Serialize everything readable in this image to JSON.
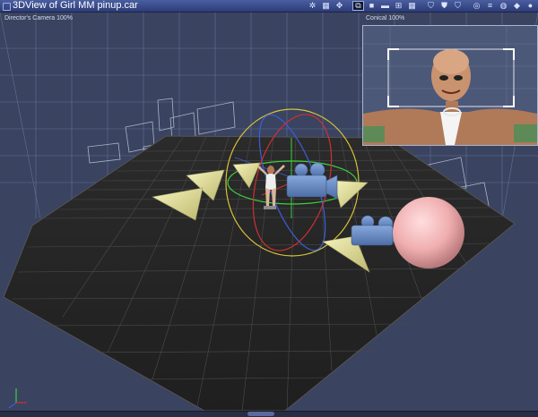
{
  "window": {
    "title": "3DView of Girl MM pinup.car"
  },
  "toolbar": {
    "items": [
      {
        "icon": "pin-icon",
        "glyph": "✲"
      },
      {
        "icon": "grid-icon",
        "glyph": "▦"
      },
      {
        "icon": "move-icon",
        "glyph": "✥"
      },
      {
        "icon": "camera-view-icon",
        "glyph": "⧉"
      },
      {
        "icon": "layout-single-icon",
        "glyph": "■"
      },
      {
        "icon": "layout-split-icon",
        "glyph": "▬"
      },
      {
        "icon": "layout-quad-icon",
        "glyph": "⊞"
      },
      {
        "icon": "layout-grid-icon",
        "glyph": "▦"
      },
      {
        "icon": "shield-icon",
        "glyph": "⛉"
      },
      {
        "icon": "light-shield-icon",
        "glyph": "⛊"
      },
      {
        "icon": "render-shield-icon",
        "glyph": "⛉"
      },
      {
        "icon": "target-icon",
        "glyph": "◎"
      },
      {
        "icon": "menu-icon",
        "glyph": "≡"
      },
      {
        "icon": "wireframe-sphere-icon",
        "glyph": "◍"
      },
      {
        "icon": "shaded-cube-icon",
        "glyph": "◆"
      },
      {
        "icon": "shaded-sphere-icon",
        "glyph": "●"
      }
    ]
  },
  "viewport": {
    "camera_label": "Director's Camera 100%",
    "preview_label": "Conical 100%"
  },
  "scene": {
    "colors": {
      "background": "#3a4360",
      "floor": "#262626",
      "grid_line": "#7d8aaa",
      "cone": "#e8e5a0",
      "camera_prop": "#6b8fc9",
      "sphere": "#f2b7b7",
      "gizmo_red": "#d03030",
      "gizmo_green": "#3ccf3c",
      "gizmo_blue": "#3b5ed8",
      "gizmo_yellow": "#d8c23a"
    }
  }
}
